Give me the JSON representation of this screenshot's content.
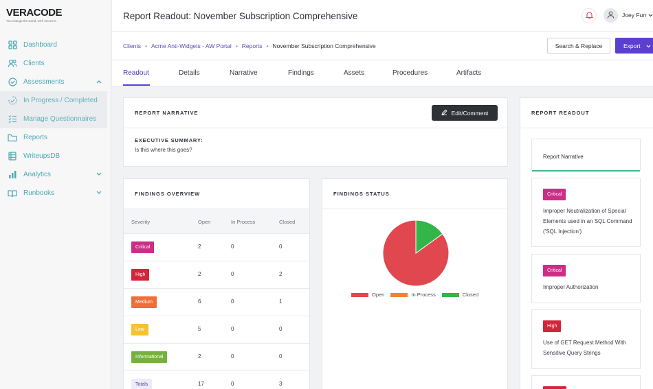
{
  "app": {
    "logo_main": "VERACODE",
    "logo_tagline": "You change the world, we'll secure it."
  },
  "sidebar": {
    "items": [
      {
        "label": "Dashboard",
        "icon": "grid-icon"
      },
      {
        "label": "Clients",
        "icon": "users-icon"
      },
      {
        "label": "Assessments",
        "icon": "check-circle-icon"
      },
      {
        "label": "In Progress / Completed",
        "icon": "progress-check-icon"
      },
      {
        "label": "Manage Questionnaires",
        "icon": "checklist-icon"
      },
      {
        "label": "Reports",
        "icon": "folder-icon"
      },
      {
        "label": "WriteupsDB",
        "icon": "database-icon"
      },
      {
        "label": "Analytics",
        "icon": "bar-chart-icon"
      },
      {
        "label": "Runbooks",
        "icon": "book-icon"
      }
    ]
  },
  "header": {
    "title": "Report Readout: November Subscription Comprehensive",
    "user_name": "Joey Furr"
  },
  "breadcrumb": {
    "items": [
      "Clients",
      "Acme Anti-Widgets - AW Portal",
      "Reports"
    ],
    "current": "November Subscription Comprehensive",
    "separator": "•"
  },
  "actions": {
    "search_replace": "Search & Replace",
    "export": "Export"
  },
  "tabs": [
    "Readout",
    "Details",
    "Narrative",
    "Findings",
    "Assets",
    "Procedures",
    "Artifacts"
  ],
  "narrative": {
    "title": "REPORT NARRATIVE",
    "edit_button": "Edit/Comment",
    "exec_label": "EXECUTIVE SUMMARY:",
    "exec_text": "Is this where this goes?"
  },
  "findings_overview": {
    "title": "FINDINGS OVERVIEW",
    "headers": [
      "Severity",
      "Open",
      "In Process",
      "Closed"
    ],
    "rows": [
      {
        "severity": "Critical",
        "open": "2",
        "in_process": "0",
        "closed": "0",
        "color": "#cc2d86"
      },
      {
        "severity": "High",
        "open": "2",
        "in_process": "0",
        "closed": "2",
        "color": "#d3263b"
      },
      {
        "severity": "Medium",
        "open": "6",
        "in_process": "0",
        "closed": "1",
        "color": "#ef6f3a"
      },
      {
        "severity": "Low",
        "open": "5",
        "in_process": "0",
        "closed": "0",
        "color": "#f5c331"
      },
      {
        "severity": "Informational",
        "open": "2",
        "in_process": "0",
        "closed": "0",
        "color": "#76b041"
      },
      {
        "severity": "Totals",
        "open": "17",
        "in_process": "0",
        "closed": "3",
        "color": "#ecebf7"
      }
    ]
  },
  "findings_status": {
    "title": "FINDINGS STATUS"
  },
  "chart_data": {
    "type": "pie",
    "labels": [
      "Open",
      "In Process",
      "Closed"
    ],
    "values": [
      17,
      0,
      3
    ],
    "colors": [
      "#e0474f",
      "#f0823b",
      "#34b54a"
    ],
    "legend": "bottom"
  },
  "readout": {
    "title": "REPORT READOUT",
    "tab_label": "Report Narrative",
    "items": [
      {
        "severity": "Critical",
        "color": "#cc2d86",
        "desc": "Improper Neutralization of Special Elements used in an SQL Command ('SQL Injection')"
      },
      {
        "severity": "Critical",
        "color": "#cc2d86",
        "desc": "Improper Authorization"
      },
      {
        "severity": "High",
        "color": "#d3263b",
        "desc": "Use of GET Request Method With Sensitive Query Strings"
      }
    ]
  }
}
